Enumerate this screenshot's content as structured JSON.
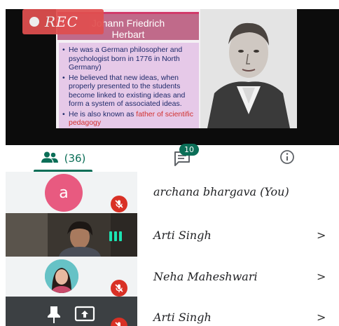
{
  "recording": {
    "label": "REC"
  },
  "slide": {
    "title_line1": "Johann Friedrich",
    "title_line2": "Herbart",
    "bullets": [
      "He was a German philosopher and psychologist  born in 1776 in North Germany)",
      "He believed that new ideas, when properly presented to the students become linked to existing ideas and form a system of associated ideas."
    ],
    "bullet3_prefix": "He is also known as ",
    "bullet3_highlight": "father of scientific pedagogy"
  },
  "tabs": {
    "people_count": "(36)",
    "chat_badge": "10"
  },
  "participants": [
    {
      "name": "archana bhargava (You)",
      "avatar_letter": "a",
      "chevron": ""
    },
    {
      "name": "Arti Singh",
      "chevron": ">"
    },
    {
      "name": "Neha Maheshwari",
      "chevron": ">"
    },
    {
      "name": "Arti Singh",
      "chevron": ">"
    }
  ],
  "colors": {
    "accent": "#0b6e57",
    "mute_red": "#d93025",
    "avatar_pink": "#e85a80",
    "audio_level": "#1ce3b2"
  },
  "icons": [
    "people-icon",
    "chat-icon",
    "info-icon",
    "mic-off-icon",
    "audio-level-icon",
    "pin-icon",
    "present-screen-icon",
    "record-dot-icon"
  ]
}
